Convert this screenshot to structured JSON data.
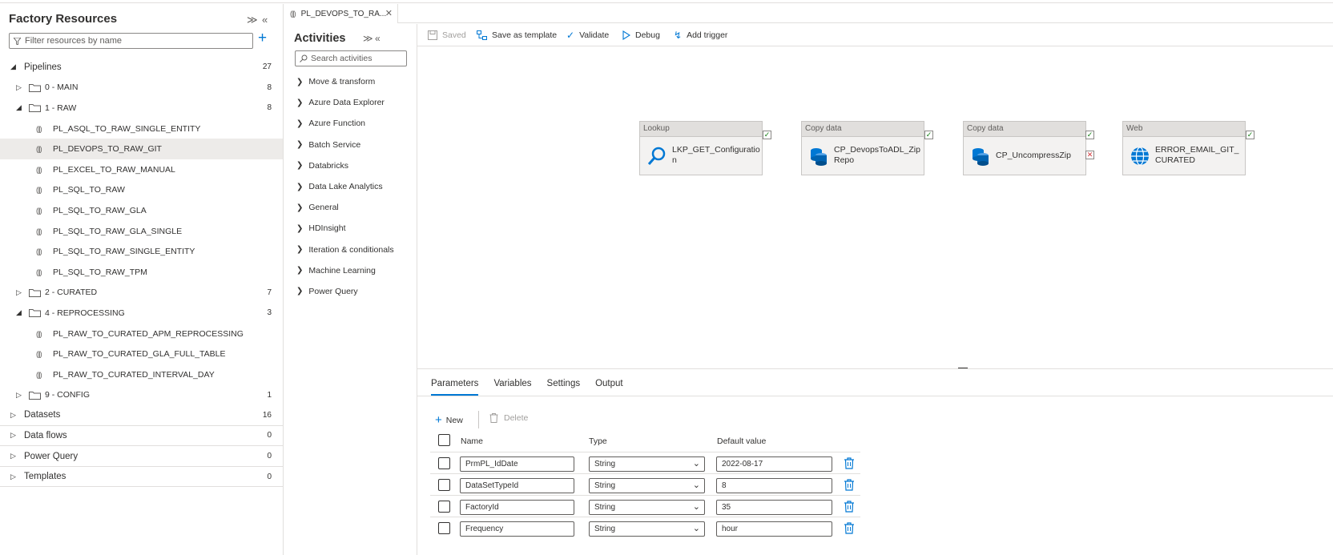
{
  "resources": {
    "title": "Factory Resources",
    "filter_placeholder": "Filter resources by name",
    "pipelines": {
      "label": "Pipelines",
      "count": "27",
      "folders": [
        {
          "name": "0 - MAIN",
          "count": "8",
          "expanded": false,
          "items": []
        },
        {
          "name": "1 - RAW",
          "count": "8",
          "expanded": true,
          "items": [
            "PL_ASQL_TO_RAW_SINGLE_ENTITY",
            "PL_DEVOPS_TO_RAW_GIT",
            "PL_EXCEL_TO_RAW_MANUAL",
            "PL_SQL_TO_RAW",
            "PL_SQL_TO_RAW_GLA",
            "PL_SQL_TO_RAW_GLA_SINGLE",
            "PL_SQL_TO_RAW_SINGLE_ENTITY",
            "PL_SQL_TO_RAW_TPM"
          ]
        },
        {
          "name": "2 - CURATED",
          "count": "7",
          "expanded": false,
          "items": []
        },
        {
          "name": "4 - REPROCESSING",
          "count": "3",
          "expanded": true,
          "items": [
            "PL_RAW_TO_CURATED_APM_REPROCESSING",
            "PL_RAW_TO_CURATED_GLA_FULL_TABLE",
            "PL_RAW_TO_CURATED_INTERVAL_DAY"
          ]
        },
        {
          "name": "9 - CONFIG",
          "count": "1",
          "expanded": false,
          "items": []
        }
      ]
    },
    "sections": [
      {
        "label": "Datasets",
        "count": "16"
      },
      {
        "label": "Data flows",
        "count": "0"
      },
      {
        "label": "Power Query",
        "count": "0"
      },
      {
        "label": "Templates",
        "count": "0"
      }
    ],
    "selected_item": "PL_DEVOPS_TO_RAW_GIT"
  },
  "tab": {
    "label": "PL_DEVOPS_TO_RA..."
  },
  "activities": {
    "title": "Activities",
    "search_placeholder": "Search activities",
    "items": [
      "Move & transform",
      "Azure Data Explorer",
      "Azure Function",
      "Batch Service",
      "Databricks",
      "Data Lake Analytics",
      "General",
      "HDInsight",
      "Iteration & conditionals",
      "Machine Learning",
      "Power Query"
    ]
  },
  "toolbar": {
    "saved": "Saved",
    "save_template": "Save as template",
    "validate": "Validate",
    "debug": "Debug",
    "add_trigger": "Add trigger"
  },
  "nodes": [
    {
      "type": "Lookup",
      "name": "LKP_GET_Configuration",
      "icon": "search-icon"
    },
    {
      "type": "Copy data",
      "name": "CP_DevopsToADL_ZipRepo",
      "icon": "database-icon"
    },
    {
      "type": "Copy data",
      "name": "CP_UncompressZip",
      "icon": "database-icon"
    },
    {
      "type": "Web",
      "name": "ERROR_EMAIL_GIT_CURATED",
      "icon": "globe-icon"
    }
  ],
  "bottom": {
    "tabs": [
      "Parameters",
      "Variables",
      "Settings",
      "Output"
    ],
    "active_tab": "Parameters",
    "new_label": "New",
    "delete_label": "Delete",
    "columns": [
      "Name",
      "Type",
      "Default value"
    ],
    "params": [
      {
        "name": "PrmPL_IdDate",
        "type": "String",
        "default": "2022-08-17"
      },
      {
        "name": "DataSetTypeId",
        "type": "String",
        "default": "8"
      },
      {
        "name": "FactoryId",
        "type": "String",
        "default": "35"
      },
      {
        "name": "Frequency",
        "type": "String",
        "default": "hour"
      }
    ]
  },
  "colors": {
    "accent": "#0078d4",
    "success": "#107c10",
    "failure": "#d13438"
  }
}
